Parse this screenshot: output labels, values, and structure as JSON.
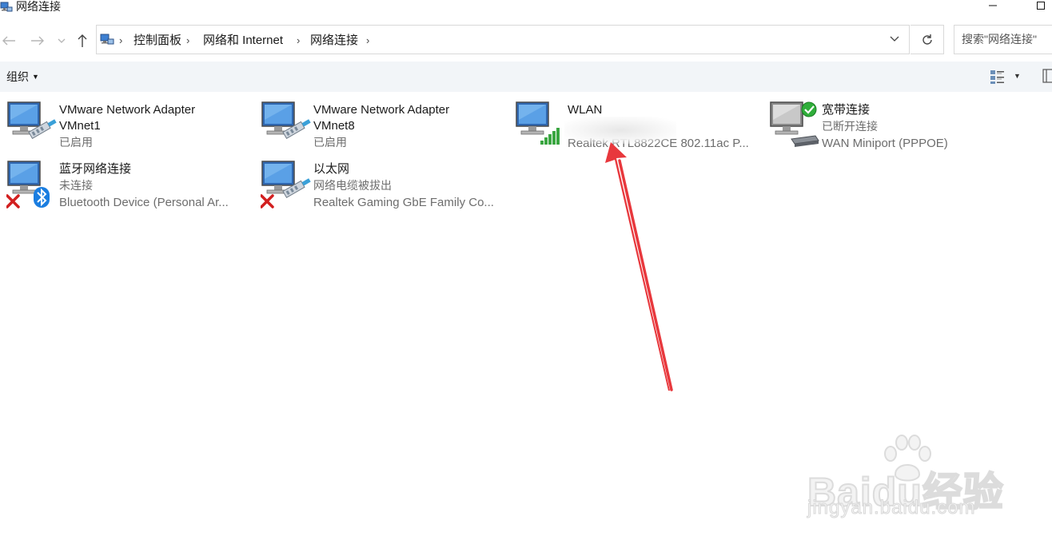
{
  "window": {
    "title": "网络连接"
  },
  "address_bar": {
    "crumbs": [
      "控制面板",
      "网络和 Internet",
      "网络连接"
    ]
  },
  "search": {
    "placeholder": "搜索\"网络连接\""
  },
  "commandbar": {
    "organize_label": "组织"
  },
  "connections": [
    {
      "name": "VMware Network Adapter VMnet1",
      "name_line1": "VMware Network Adapter",
      "name_line2": "VMnet1",
      "status": "已启用",
      "device": "",
      "kind": "wired",
      "state": "enabled"
    },
    {
      "name": "VMware Network Adapter VMnet8",
      "name_line1": "VMware Network Adapter",
      "name_line2": "VMnet8",
      "status": "已启用",
      "device": "",
      "kind": "wired",
      "state": "enabled"
    },
    {
      "name": "WLAN",
      "status": "",
      "device": "Realtek RTL8822CE 802.11ac P...",
      "kind": "wifi",
      "state": "connected"
    },
    {
      "name": "宽带连接",
      "status": "已断开连接",
      "device": "WAN Miniport (PPPOE)",
      "kind": "broadband",
      "state": "disconnected"
    },
    {
      "name": "蓝牙网络连接",
      "status": "未连接",
      "device": "Bluetooth Device (Personal Ar...",
      "kind": "bluetooth",
      "state": "error"
    },
    {
      "name": "以太网",
      "status": "网络电缆被拔出",
      "device": "Realtek Gaming GbE Family Co...",
      "kind": "wired",
      "state": "error"
    }
  ],
  "watermark": {
    "brand": "Baidu经验",
    "url": "jingyan.baidu.com"
  },
  "colors": {
    "arrow": "#e8383d",
    "error": "#d21f1f",
    "bluetooth": "#1a7de0",
    "wifi": "#3aa641",
    "ok": "#2fae3a",
    "command_bar": "#f2f5f8"
  }
}
